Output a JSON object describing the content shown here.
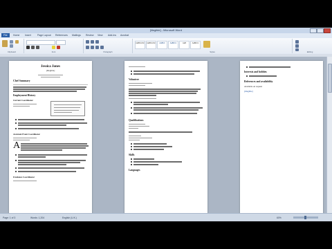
{
  "window": {
    "title": "[illegible] - Microsoft Word"
  },
  "ribbon": {
    "tabs": [
      "File",
      "Home",
      "Insert",
      "Page Layout",
      "References",
      "Mailings",
      "Review",
      "View",
      "Add-Ins",
      "Acrobat"
    ],
    "styles": [
      "AaBbCcDc",
      "AaBbCcDc",
      "AaBbC",
      "AaBbCc",
      "AaB",
      "AaBbCc"
    ],
    "groups": [
      "Clipboard",
      "Font",
      "Paragraph",
      "Styles",
      "Editing"
    ]
  },
  "document": {
    "page1": {
      "name": "Jessica Jones",
      "contact": "[illegible]",
      "summary_heading": "Chef Summary",
      "experience_heading": "Employment History",
      "job1_title": "Current Coordinator",
      "job2_title": "Assistant Event Coordinator",
      "job3_title": "Freelance Coordinator"
    },
    "page2": {
      "volunteer_heading": "Volunteer",
      "qualifications_heading": "Qualifications",
      "skills_heading": "Skills",
      "languages_heading": "Languages"
    },
    "page3": {
      "interests_heading": "Interests and hobbies",
      "references_heading": "References and availability",
      "references_text": "Available on request",
      "footer_link": "[illegible]"
    }
  },
  "status": {
    "page": "Page: 1 of 3",
    "words": "Words: 1,204",
    "language": "English (U.K.)",
    "zoom": "60%"
  }
}
